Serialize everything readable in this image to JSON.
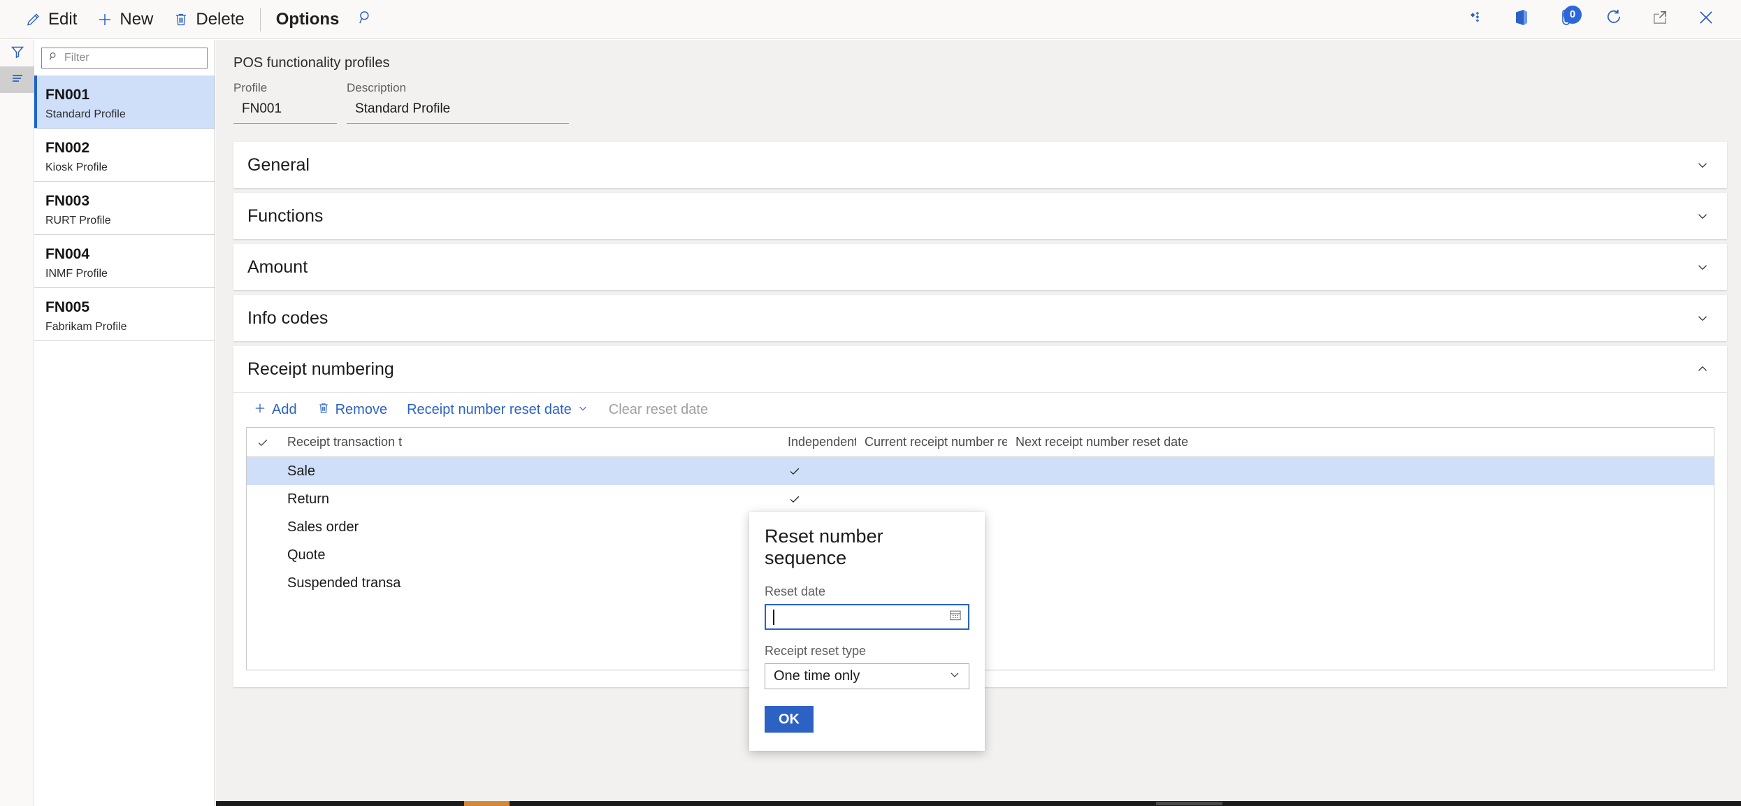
{
  "commandbar": {
    "buttons": [
      {
        "label": "Edit",
        "icon": "pencil-icon"
      },
      {
        "label": "New",
        "icon": "plus-icon"
      },
      {
        "label": "Delete",
        "icon": "trash-icon"
      }
    ],
    "options_label": "Options",
    "search_icon": "search-icon",
    "right_icons": [
      {
        "name": "dynamics-diamond-icon"
      },
      {
        "name": "office-apps-icon"
      },
      {
        "name": "attachments-icon",
        "badge": "0"
      },
      {
        "name": "refresh-icon"
      },
      {
        "name": "open-in-new-window-icon"
      },
      {
        "name": "close-icon"
      }
    ]
  },
  "rail": {
    "filter_icon": "filter-funnel-icon",
    "list_icon": "list-lines-icon"
  },
  "listpane": {
    "filter_placeholder": "Filter",
    "filter_value": "",
    "items": [
      {
        "id": "FN001",
        "desc": "Standard Profile",
        "selected": true
      },
      {
        "id": "FN002",
        "desc": "Kiosk Profile",
        "selected": false
      },
      {
        "id": "FN003",
        "desc": "RURT Profile",
        "selected": false
      },
      {
        "id": "FN004",
        "desc": "INMF Profile",
        "selected": false
      },
      {
        "id": "FN005",
        "desc": "Fabrikam Profile",
        "selected": false
      }
    ]
  },
  "header": {
    "page_title": "POS functionality profiles",
    "profile_label": "Profile",
    "profile_value": "FN001",
    "description_label": "Description",
    "description_value": "Standard Profile"
  },
  "sections": [
    {
      "title": "General",
      "expanded": false
    },
    {
      "title": "Functions",
      "expanded": false
    },
    {
      "title": "Amount",
      "expanded": false
    },
    {
      "title": "Info codes",
      "expanded": false
    },
    {
      "title": "Receipt numbering",
      "expanded": true
    }
  ],
  "grid_toolbar": {
    "add_label": "Add",
    "remove_label": "Remove",
    "reset_date_label": "Receipt number reset date",
    "clear_reset_label": "Clear reset date"
  },
  "grid": {
    "columns": [
      "Receipt transaction t",
      "Independent se...",
      "Current receipt number reset date",
      "Next receipt number reset date"
    ],
    "rows": [
      {
        "type": "Sale",
        "independent": true,
        "current": "",
        "next": "",
        "selected": true
      },
      {
        "type": "Return",
        "independent": true,
        "current": "",
        "next": "",
        "selected": false
      },
      {
        "type": "Sales order",
        "independent": true,
        "current": "",
        "next": "",
        "selected": false
      },
      {
        "type": "Quote",
        "independent": true,
        "current": "",
        "next": "",
        "selected": false
      },
      {
        "type": "Suspended transa",
        "independent": true,
        "current": "",
        "next": "",
        "selected": false
      }
    ]
  },
  "dialog": {
    "title": "Reset number sequence",
    "reset_date_label": "Reset date",
    "reset_date_value": "",
    "reset_type_label": "Receipt reset type",
    "reset_type_value": "One time only",
    "ok_label": "OK",
    "calendar_icon": "calendar-icon",
    "chevron_icon": "chevron-down-icon"
  },
  "colors": {
    "accent": "#2b62c4",
    "selection": "#cfdffa",
    "selection_bar": "#1f63c8",
    "chrome": "#faf9f8",
    "canvas": "#f2f1f0"
  }
}
